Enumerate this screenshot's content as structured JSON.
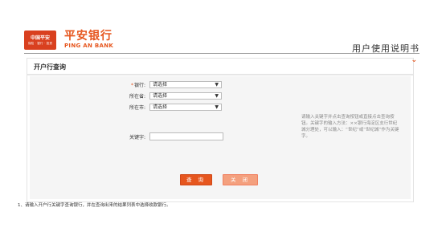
{
  "header": {
    "logo_line1": "中国平安",
    "logo_line2": "保险 · 银行 · 投资",
    "brand_cn": "平安银行",
    "brand_en": "PING AN BANK",
    "manual_title": "用户使用说明书"
  },
  "panel": {
    "title": "开户行查询"
  },
  "form": {
    "bank": {
      "required_mark": "*",
      "label": "银行:",
      "value": "请选择"
    },
    "province": {
      "label": "所在省:",
      "value": "请选择"
    },
    "city": {
      "label": "所在市:",
      "value": "请选择"
    },
    "keyword": {
      "label": "关键字:",
      "value": ""
    },
    "hint": "请输入关键字并点击查询按钮或直接点击查询按钮。关键字的输入方法：××银行海淀区支行世纪城分理处，可以输入：“世纪”或“世纪城”作为关键字。",
    "query_button": "查 询",
    "close_button": "关 闭"
  },
  "footnote": "1、请输入开户行关键字查询银行，并在查询出来的结果列表中选择收款银行。",
  "colors": {
    "brand_orange": "#e6561e",
    "logo_red": "#d9401f",
    "panel_bg": "#f5f5f5"
  }
}
